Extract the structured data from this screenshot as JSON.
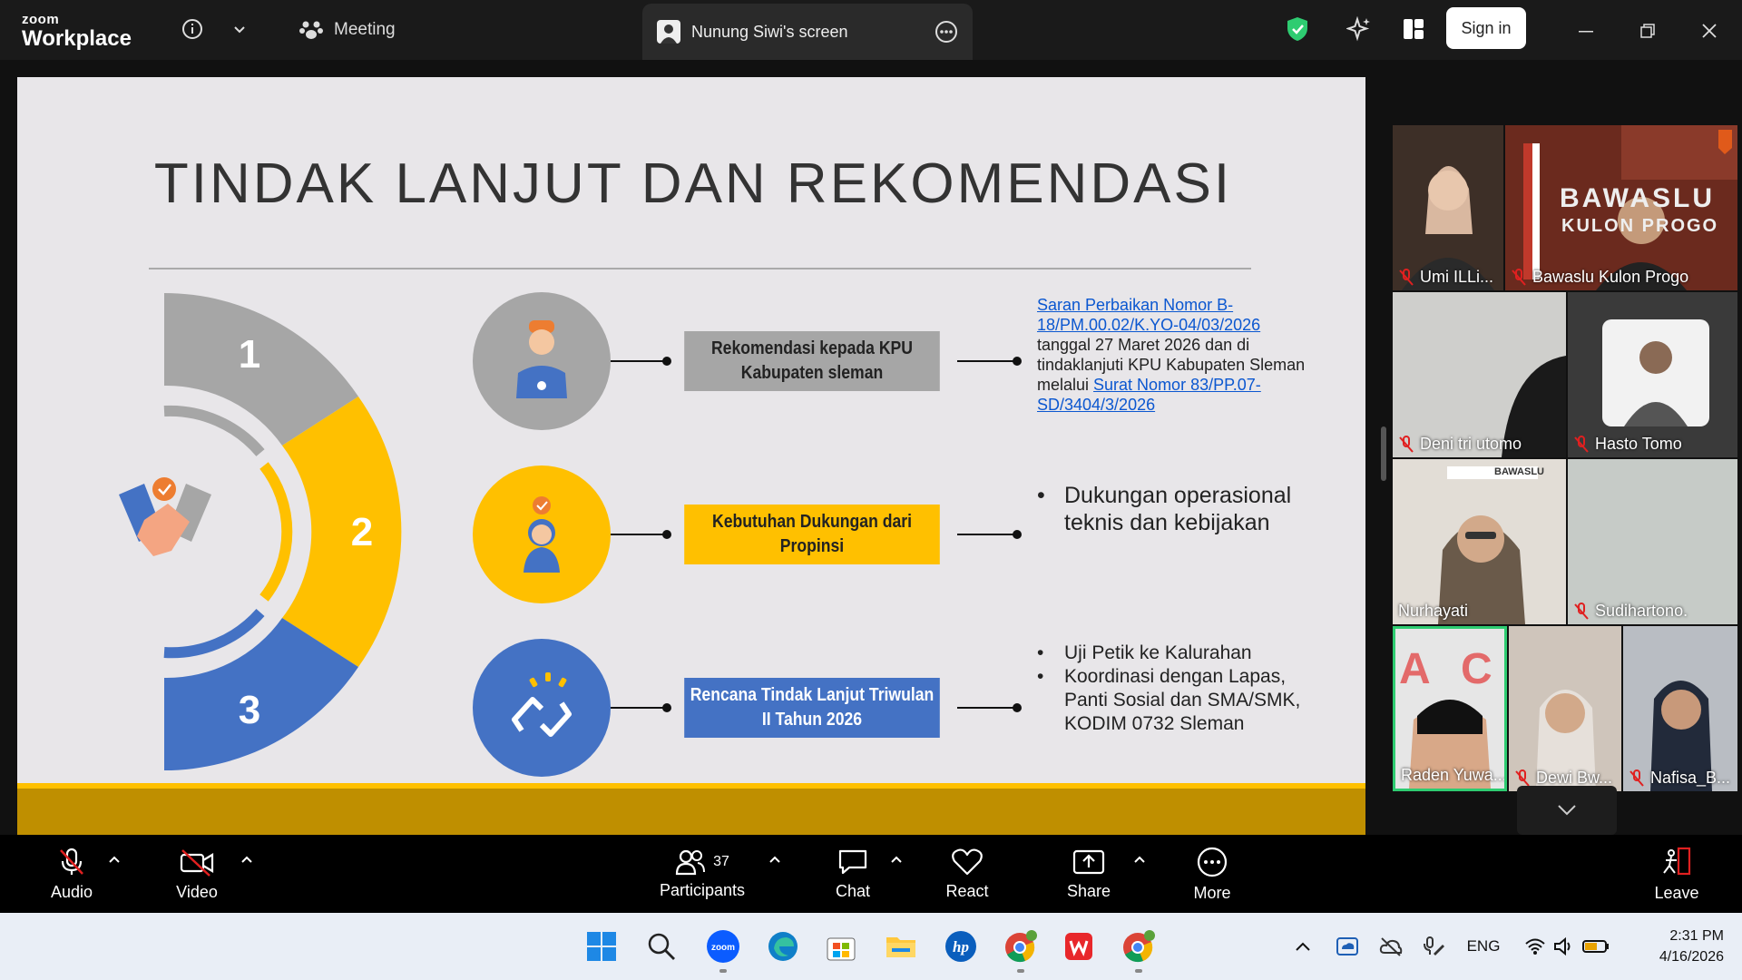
{
  "titlebar": {
    "logo_line1": "zoom",
    "logo_line2": "Workplace",
    "meeting_label": "Meeting",
    "screen_tab_label": "Nunung Siwi's screen",
    "signin_label": "Sign in"
  },
  "slide": {
    "title": "TINDAK LANJUT DAN REKOMENDASI",
    "numbers": [
      "1",
      "2",
      "3"
    ],
    "boxes": [
      {
        "line1": "Rekomendasi kepada KPU",
        "line2": "Kabupaten sleman",
        "color": "#a6a6a6"
      },
      {
        "line1": "Kebutuhan Dukungan dari",
        "line2": "Propinsi",
        "color": "#ffc000"
      },
      {
        "line1": "Rencana Tindak Lanjut Triwulan",
        "line2": "II Tahun 2026",
        "color": "#4472c4"
      }
    ],
    "desc1": {
      "link1": "Saran Perbaikan Nomor B-18/PM.00.02/K.YO-04/03/2026",
      "text": " tanggal 27 Maret 2026 dan di tindaklanjuti KPU Kabupaten Sleman melalui ",
      "link2": "Surat Nomor 83/PP.07-SD/3404/3/2026"
    },
    "desc2_bullets": [
      "Dukungan operasional teknis dan kebijakan"
    ],
    "desc3_bullets": [
      "Uji Petik ke Kalurahan",
      "Koordinasi dengan Lapas, Panti Sosial dan SMA/SMK, KODIM 0732 Sleman"
    ],
    "bullet_char": "•"
  },
  "participants": [
    {
      "name": "Umi ILLi...",
      "muted": true
    },
    {
      "name": "Bawaslu Kulon Progo",
      "muted": true,
      "sign_line1": "BAWASLU",
      "sign_line2": "KULON PROGO"
    },
    {
      "name": "Deni tri utomo",
      "muted": true
    },
    {
      "name": "Hasto Tomo",
      "muted": true
    },
    {
      "name": "Nurhayati",
      "muted": false,
      "banner": "BAWASLU"
    },
    {
      "name": "Sudihartono.",
      "muted": true
    },
    {
      "name": "Raden Yuwa...",
      "muted": false,
      "active_speaker": true
    },
    {
      "name": "Dewi Bw...",
      "muted": true
    },
    {
      "name": "Nafisa_B...",
      "muted": true
    }
  ],
  "controls": {
    "audio": "Audio",
    "video": "Video",
    "participants": "Participants",
    "participant_count": "37",
    "chat": "Chat",
    "react": "React",
    "share": "Share",
    "more": "More",
    "leave": "Leave"
  },
  "taskbar": {
    "lang": "ENG",
    "time": "2:31 PM",
    "date": "4/16/2026",
    "zoom_icon_text": "zoom",
    "hp_icon_text": "hp"
  },
  "colors": {
    "accent_green": "#2ecc71",
    "leave_red": "#e02020",
    "slide_gray": "#a6a6a6",
    "slide_yellow": "#ffc000",
    "slide_blue": "#4472c4",
    "link": "#0b57d0"
  }
}
